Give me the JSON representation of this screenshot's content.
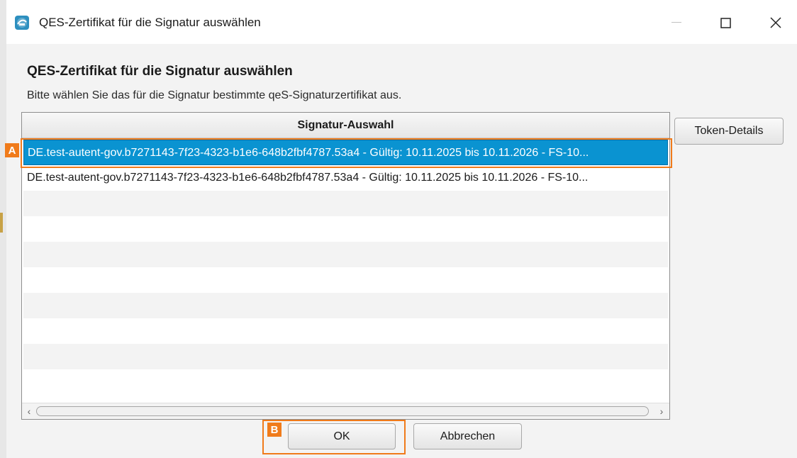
{
  "window": {
    "title": "QES-Zertifikat für die Signatur auswählen",
    "minimize_icon": "minimize-icon",
    "maximize_icon": "maximize-icon",
    "close_icon": "close-icon"
  },
  "dialog": {
    "heading": "QES-Zertifikat für die Signatur auswählen",
    "description": "Bitte wählen Sie das für die Signatur bestimmte qeS-Signaturzertifikat aus."
  },
  "table": {
    "column_header": "Signatur-Auswahl",
    "rows": [
      "DE.test-autent-gov.b7271143-7f23-4323-b1e6-648b2fbf4787.53a4 -  Gültig: 10.11.2025 bis 10.11.2026 - FS-10...",
      "DE.test-autent-gov.b7271143-7f23-4323-b1e6-648b2fbf4787.53a4 -  Gültig: 10.11.2025 bis 10.11.2026 - FS-10..."
    ],
    "selected_row": 0
  },
  "buttons": {
    "token_details": "Token-Details",
    "ok": "OK",
    "cancel": "Abbrechen"
  },
  "annotations": {
    "a": "A",
    "b": "B",
    "color": "#f07b1b"
  },
  "colors": {
    "selection": "#0a93d1"
  }
}
